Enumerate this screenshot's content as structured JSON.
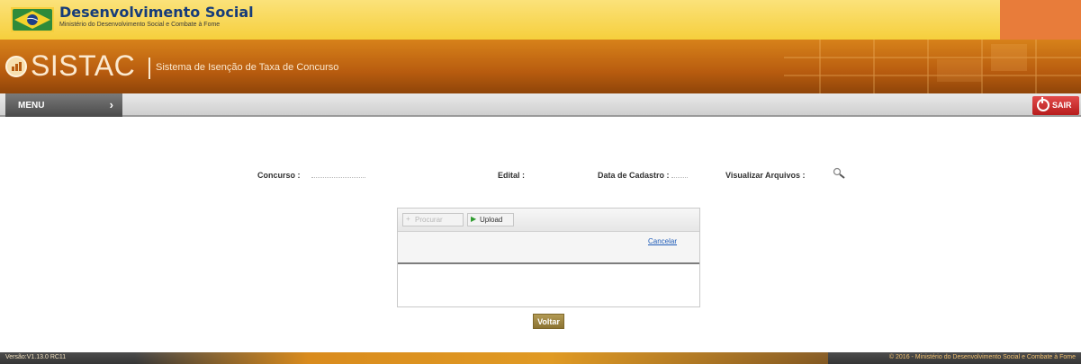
{
  "header": {
    "ministry_title": "Desenvolvimento Social",
    "ministry_subtitle": "Ministério do Desenvolvimento Social e Combate à Fome",
    "app_name": "SISTAC",
    "app_subtitle": "Sistema de Isenção de Taxa de Concurso"
  },
  "menu": {
    "menu_label": "MENU",
    "menu_arrow": "›",
    "sair_label": "SAIR"
  },
  "info": {
    "concurso_label": "Concurso :",
    "edital_label": "Edital :",
    "data_cadastro_label": "Data de Cadastro :",
    "visualizar_arquivos_label": "Visualizar Arquivos :"
  },
  "upload": {
    "procurar_label": "Procurar",
    "upload_label": "Upload",
    "cancelar_label": "Cancelar"
  },
  "actions": {
    "voltar_label": "Voltar"
  },
  "footer": {
    "version": "Versão:V1.13.0 RC11",
    "copyright": "© 2016 - Ministério do Desenvolvimento Social e Combate à Fome"
  },
  "colors": {
    "top_bar": "#f6cf3c",
    "brand_orange": "#b85c0f",
    "menu_dark": "#4a4a4a",
    "sair_red": "#c62828",
    "voltar_gold": "#9c8340",
    "link_blue": "#1f5cb8"
  },
  "icons": {
    "ministry_logo": "brazil-flag-logo-icon",
    "sistac": "chart-bars-icon",
    "visualizar": "magnifier-icon",
    "procurar": "plus-icon",
    "upload": "play-arrow-icon",
    "sair": "power-icon"
  }
}
